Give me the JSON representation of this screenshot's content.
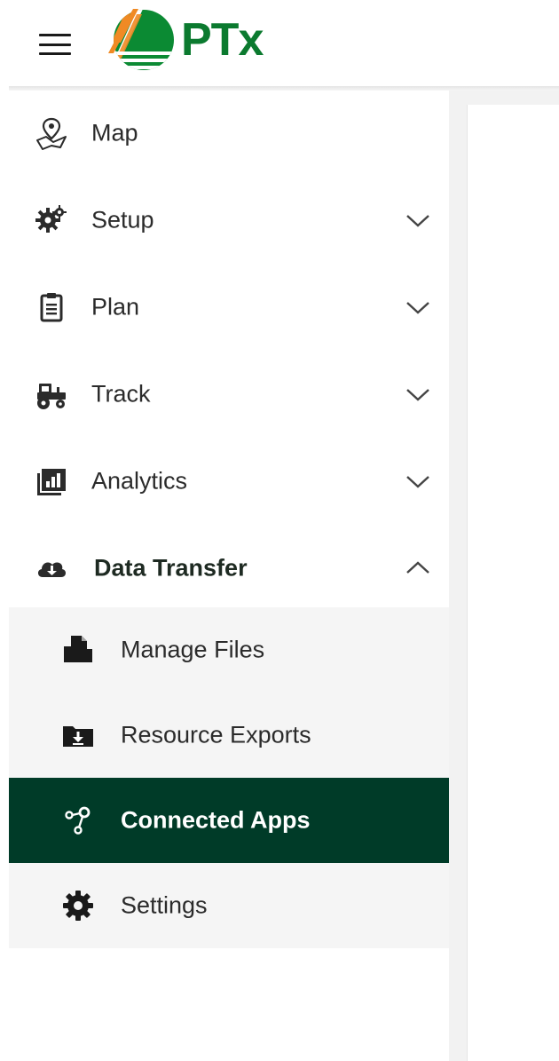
{
  "header": {
    "menu_icon": "hamburger-menu-icon",
    "logo_text": "PTx",
    "colors": {
      "logo_green": "#0b7a2f",
      "logo_orange": "#f08a24"
    }
  },
  "sidebar": {
    "items": [
      {
        "label": "Map",
        "icon": "map-pin-icon",
        "expandable": false
      },
      {
        "label": "Setup",
        "icon": "setup-gears-icon",
        "expandable": true,
        "expanded": false
      },
      {
        "label": "Plan",
        "icon": "clipboard-icon",
        "expandable": true,
        "expanded": false
      },
      {
        "label": "Track",
        "icon": "tractor-icon",
        "expandable": true,
        "expanded": false
      },
      {
        "label": "Analytics",
        "icon": "analytics-chart-icon",
        "expandable": true,
        "expanded": false
      },
      {
        "label": "Data Transfer",
        "icon": "cloud-download-icon",
        "expandable": true,
        "expanded": true
      }
    ],
    "data_transfer_children": [
      {
        "label": "Manage Files",
        "icon": "file-folder-icon",
        "active": false
      },
      {
        "label": "Resource Exports",
        "icon": "folder-download-icon",
        "active": false
      },
      {
        "label": "Connected Apps",
        "icon": "connected-apps-icon",
        "active": true
      },
      {
        "label": "Settings",
        "icon": "gear-icon",
        "active": false
      }
    ],
    "colors": {
      "active_bg": "#003b28",
      "submenu_bg": "#f5f5f5",
      "text": "#2b2b2b"
    }
  }
}
